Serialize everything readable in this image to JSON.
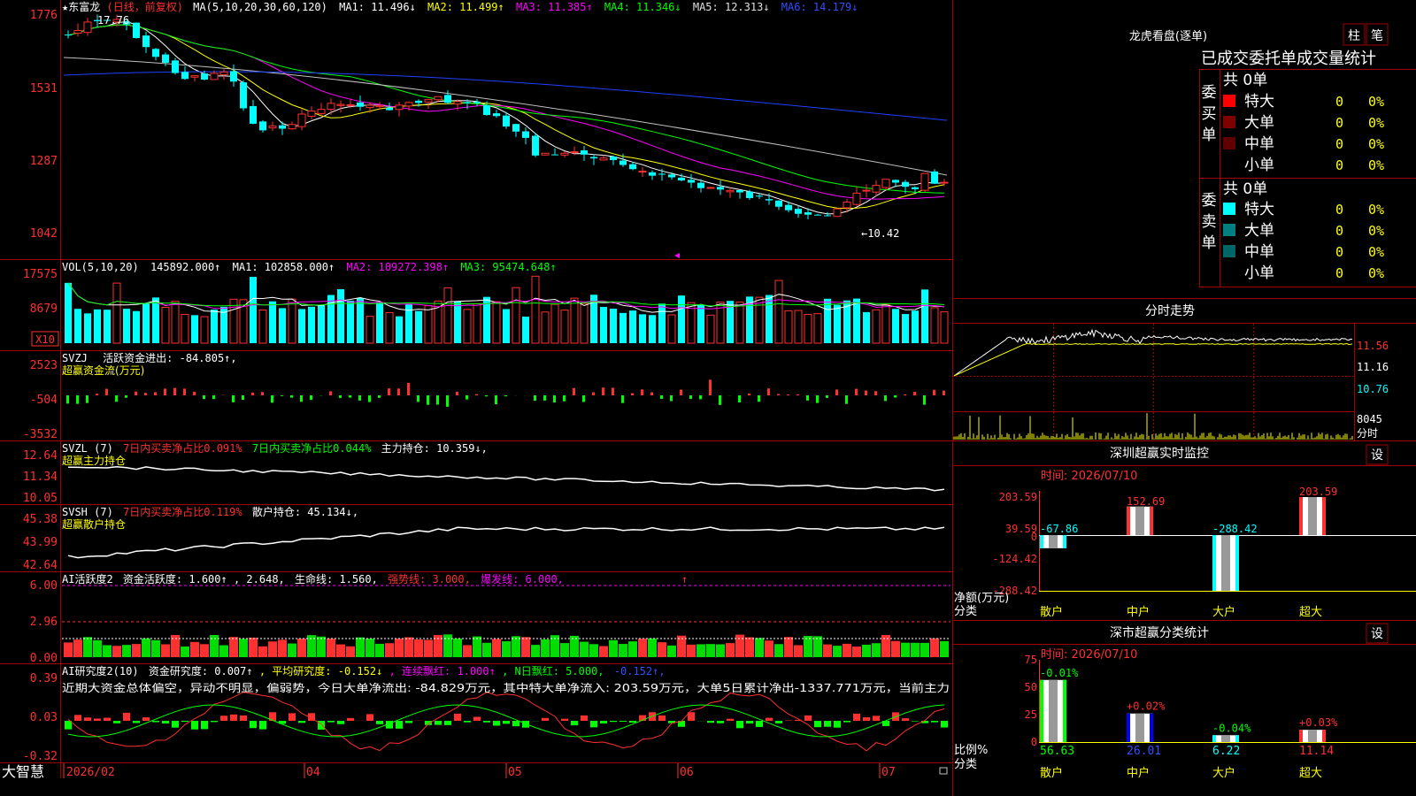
{
  "app": {
    "name": "大智慧"
  },
  "main": {
    "title": "★东富龙",
    "period": "(日线，前复权)",
    "ma_params": "MA(5,10,20,30,60,120)",
    "ma1": "MA1: 11.496↓",
    "ma2": "MA2: 11.499↑",
    "ma3": "MA3: 11.385↑",
    "ma4": "MA4: 11.346↓",
    "ma5": "MA5: 12.313↓",
    "ma6": "MA6: 14.179↓",
    "high_label": "17.76",
    "low_label": "←10.42",
    "y_ticks": [
      "1776",
      "1531",
      "1287",
      "1042"
    ]
  },
  "vol": {
    "title": "VOL(5,10,20)",
    "value": "145892.000↑",
    "ma1": "MA1: 102858.000↑",
    "ma2": "MA2: 109272.398↑",
    "ma3": "MA3: 95474.648↑",
    "y_ticks": [
      "17575",
      "8679"
    ],
    "unit": "X10"
  },
  "svzj": {
    "title": "SVZJ",
    "label": "活跃资金进出: -84.805↑,",
    "subtitle": "超赢资金流(万元)",
    "y_ticks": [
      "2523",
      "-504",
      "-3532"
    ]
  },
  "svzl": {
    "title": "SVZL (7)",
    "a": "7日内买卖净占比0.091%",
    "b": "7日内买卖净占比0.044%",
    "c": "主力持仓: 10.359↓,",
    "subtitle": "超赢主力持仓",
    "y_ticks": [
      "12.64",
      "11.34",
      "10.05"
    ]
  },
  "svsh": {
    "title": "SVSH (7)",
    "a": "7日内买卖净占比0.119%",
    "b": "散户持仓: 45.134↓,",
    "subtitle": "超赢散户持仓",
    "y_ticks": [
      "45.38",
      "43.99",
      "42.64"
    ]
  },
  "ai1": {
    "title": "AI活跃度2",
    "a": "资金活跃度: 1.600↑",
    "b": ", 2.648,",
    "c": "生命线: 1.560,",
    "d": "强势线: 3.000,",
    "e": "爆发线: 6.000,",
    "y_ticks": [
      "6.00",
      "2.96",
      "0.00"
    ]
  },
  "ai2": {
    "title": "AI研究度2(10)",
    "a": "资金研究度: 0.007↑",
    "b": ", 平均研究度: -0.152↓",
    "c": ", 连续飘红: 1.000↑",
    "d": ", N日飘红: 5.000,",
    "e": "-0.152↑,",
    "text": "近期大资金总体偏空，异动不明显，偏弱势，今日大单净流出: -84.829万元，其中特大单净流入: 203.59万元，大单5日累计净出-1337.771万元，当前主力",
    "y_ticks": [
      "0.39",
      "0.03",
      "-0.32"
    ]
  },
  "dates": [
    "2026/02",
    "04",
    "05",
    "06",
    "07"
  ],
  "right": {
    "lhb": {
      "title": "龙虎看盘(逐单)",
      "btn_zhu": "柱",
      "btn_bi": "笔",
      "heading": "已成交委托单成交量统计",
      "buy": {
        "label": "委买单",
        "total": "共 0单",
        "rows": [
          {
            "name": "特大",
            "val": "0",
            "pct": "0%",
            "color": "#ff0000"
          },
          {
            "name": "大单",
            "val": "0",
            "pct": "0%",
            "color": "#800000"
          },
          {
            "name": "中单",
            "val": "0",
            "pct": "0%",
            "color": "#600000"
          },
          {
            "name": "小单",
            "val": "0",
            "pct": "0%",
            "color": ""
          }
        ]
      },
      "sell": {
        "label": "委卖单",
        "total": "共 0单",
        "rows": [
          {
            "name": "特大",
            "val": "0",
            "pct": "0%",
            "color": "#00ffff"
          },
          {
            "name": "大单",
            "val": "0",
            "pct": "0%",
            "color": "#008080"
          },
          {
            "name": "中单",
            "val": "0",
            "pct": "0%",
            "color": "#006666"
          },
          {
            "name": "小单",
            "val": "0",
            "pct": "0%",
            "color": ""
          }
        ]
      }
    },
    "intraday": {
      "title": "分时走势",
      "y_ticks": [
        "11.56",
        "11.16",
        "10.76"
      ],
      "vol_tick": "8045",
      "vol_unit": "分时"
    },
    "monitor": {
      "title": "深圳超赢实时监控",
      "set": "设",
      "date": "时间: 2026/07/10",
      "y_ticks": [
        "203.59",
        "39.59",
        "0",
        "-124.42",
        "-288.42"
      ],
      "ylabel1": "净额(万元)",
      "ylabel2": "分类",
      "bars": [
        {
          "cat": "散户",
          "value": -67.86,
          "label": "-67.86"
        },
        {
          "cat": "中户",
          "value": 152.69,
          "label": "152.69"
        },
        {
          "cat": "大户",
          "value": -288.42,
          "label": "-288.42"
        },
        {
          "cat": "超大",
          "value": 203.59,
          "label": "203.59"
        }
      ]
    },
    "classify": {
      "title": "深市超赢分类统计",
      "set": "设",
      "date": "时间: 2026/07/10",
      "y_ticks": [
        "75",
        "50",
        "25",
        "0"
      ],
      "ylabel1": "比例%",
      "ylabel2": "分类",
      "bars": [
        {
          "cat": "散户",
          "value": 56.63,
          "label": "56.63",
          "change": "-0.01%"
        },
        {
          "cat": "中户",
          "value": 26.01,
          "label": "26.01",
          "change": "+0.02%"
        },
        {
          "cat": "大户",
          "value": 6.22,
          "label": "6.22",
          "change": "-0.04%"
        },
        {
          "cat": "超大",
          "value": 11.14,
          "label": "11.14",
          "change": "+0.03%"
        }
      ]
    }
  }
}
